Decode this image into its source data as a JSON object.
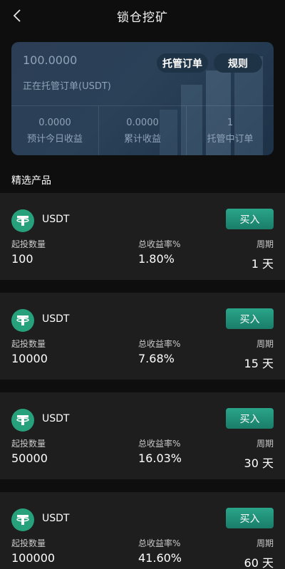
{
  "header": {
    "title": "锁仓挖矿"
  },
  "summary": {
    "amount": "100.0000",
    "amount_label": "正在托管订单(USDT)",
    "orders_button": "托管订单",
    "rules_button": "规则",
    "stats": [
      {
        "value": "0.0000",
        "label": "预计今日收益"
      },
      {
        "value": "0.0000",
        "label": "累计收益"
      },
      {
        "value": "1",
        "label": "托管中订单"
      }
    ]
  },
  "section_title": "精选产品",
  "labels": {
    "min": "起投数量",
    "rate": "总收益率%",
    "period": "周期",
    "buy": "买入"
  },
  "products": [
    {
      "coin": "USDT",
      "min": "100",
      "rate": "1.80%",
      "period": "1 天"
    },
    {
      "coin": "USDT",
      "min": "10000",
      "rate": "7.68%",
      "period": "15 天"
    },
    {
      "coin": "USDT",
      "min": "50000",
      "rate": "16.03%",
      "period": "30 天"
    },
    {
      "coin": "USDT",
      "min": "100000",
      "rate": "41.60%",
      "period": "60 天"
    }
  ],
  "colors": {
    "accent": "#26a17b",
    "card": "#1e1e1f",
    "background": "#0e0e0f"
  }
}
